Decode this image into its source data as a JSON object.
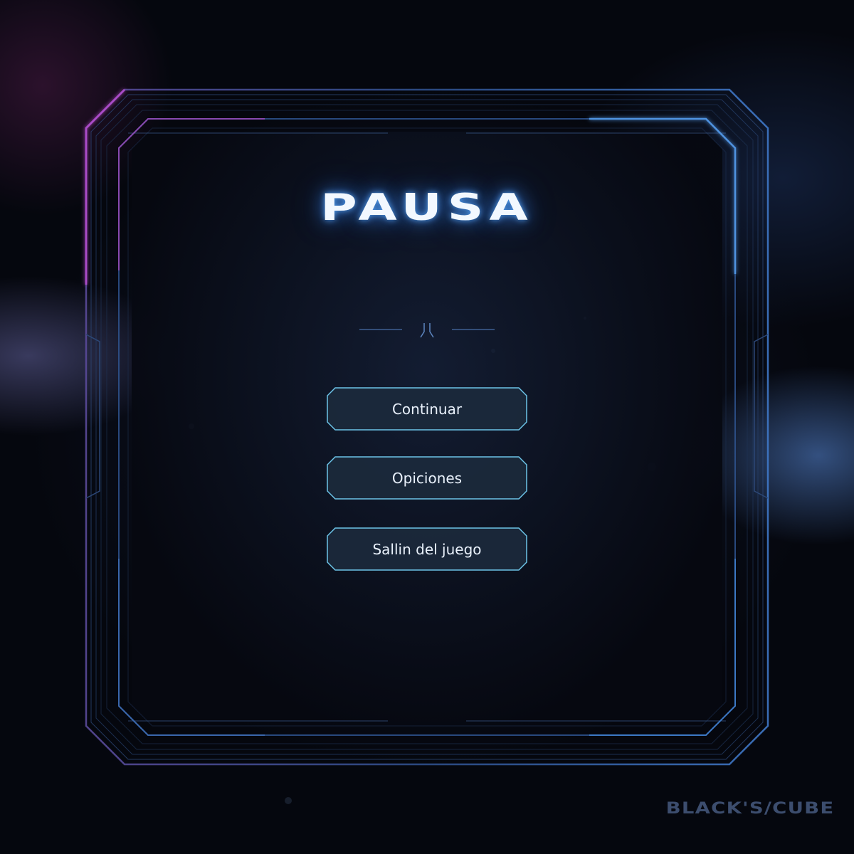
{
  "pause_menu": {
    "title": "PAUSA",
    "buttons": [
      {
        "label": "Continuar"
      },
      {
        "label": "Opiciones"
      },
      {
        "label": "Sallin del juego"
      }
    ]
  },
  "brand": {
    "logo_text": "BLACK'S/CUBE"
  },
  "colors": {
    "frame_blue": "#3d6fb8",
    "frame_glow": "#7fc0ff",
    "accent_magenta": "#c050d8",
    "button_border": "#6cc4e8",
    "button_fill": "#1c2a3c"
  }
}
